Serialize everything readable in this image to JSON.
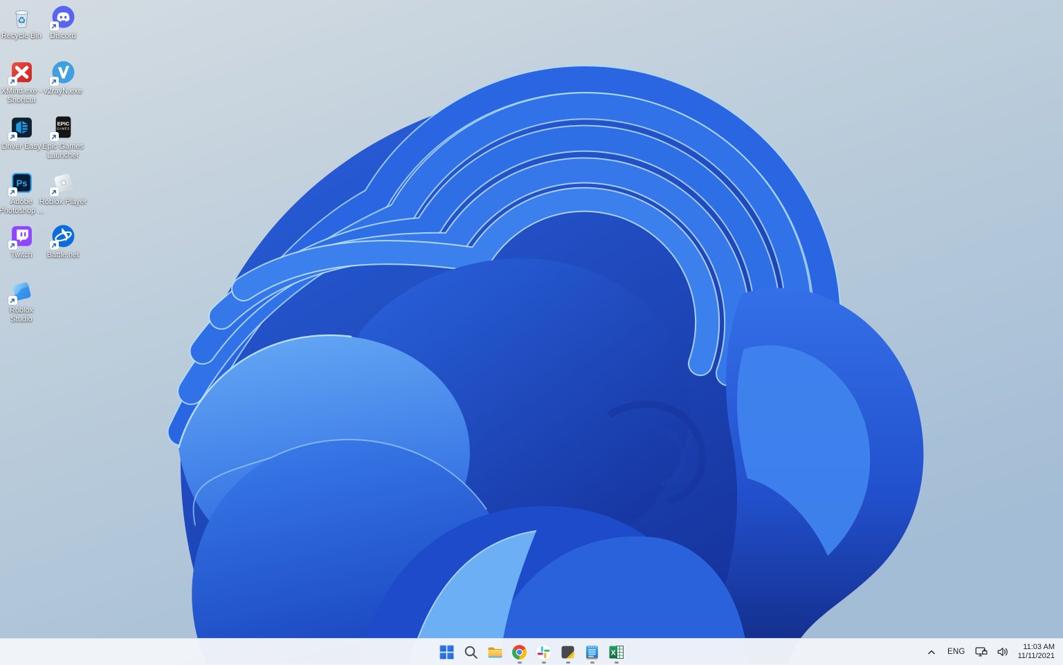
{
  "desktop": {
    "icons": [
      {
        "name": "recycle-bin",
        "lines": [
          "Recycle Bin"
        ],
        "shortcut": false
      },
      {
        "name": "discord",
        "lines": [
          "Discord"
        ],
        "shortcut": true
      },
      {
        "name": "xmind",
        "lines": [
          "XMind.exe -",
          "Shortcut"
        ],
        "shortcut": true
      },
      {
        "name": "v2rayn",
        "lines": [
          "v2rayN.exe"
        ],
        "shortcut": true
      },
      {
        "name": "driver-easy",
        "lines": [
          "Driver Easy"
        ],
        "shortcut": true
      },
      {
        "name": "epic-games-launcher",
        "lines": [
          "Epic Games",
          "Launcher"
        ],
        "shortcut": true
      },
      {
        "name": "adobe-photoshop",
        "lines": [
          "Adobe",
          "Photoshop ..."
        ],
        "shortcut": true
      },
      {
        "name": "roblox-player",
        "lines": [
          "Roblox Player"
        ],
        "shortcut": true
      },
      {
        "name": "twitch",
        "lines": [
          "Twitch"
        ],
        "shortcut": true
      },
      {
        "name": "battle-net",
        "lines": [
          "Battle.net"
        ],
        "shortcut": true
      },
      {
        "name": "roblox-studio",
        "lines": [
          "Roblox",
          "Studio"
        ],
        "shortcut": true
      }
    ]
  },
  "taskbar": {
    "items": [
      {
        "name": "start",
        "running": false
      },
      {
        "name": "search",
        "running": false
      },
      {
        "name": "file-explorer",
        "running": false
      },
      {
        "name": "chrome",
        "running": true
      },
      {
        "name": "slack",
        "running": true
      },
      {
        "name": "sticky-notes",
        "running": true
      },
      {
        "name": "notepad",
        "running": true
      },
      {
        "name": "excel",
        "running": true
      }
    ],
    "tray": {
      "chevron": "show-hidden-icons",
      "language": "ENG",
      "network_icon": "ethernet-network-icon",
      "volume_icon": "speaker-icon",
      "time": "11:03 AM",
      "date": "11/11/2021"
    }
  },
  "colors": {
    "taskbar_bg": "#f2f5f9",
    "wallpaper_top": "#d2dbe2",
    "wallpaper_bottom": "#a6c0d8",
    "bloom_dark": "#1c45c8",
    "bloom_mid": "#2e6ae4",
    "bloom_light": "#5ea6f4",
    "bloom_edge": "#b5e2fb",
    "accent_discord": "#5865f2",
    "accent_twitch": "#9146ff",
    "accent_excel": "#107c41"
  }
}
